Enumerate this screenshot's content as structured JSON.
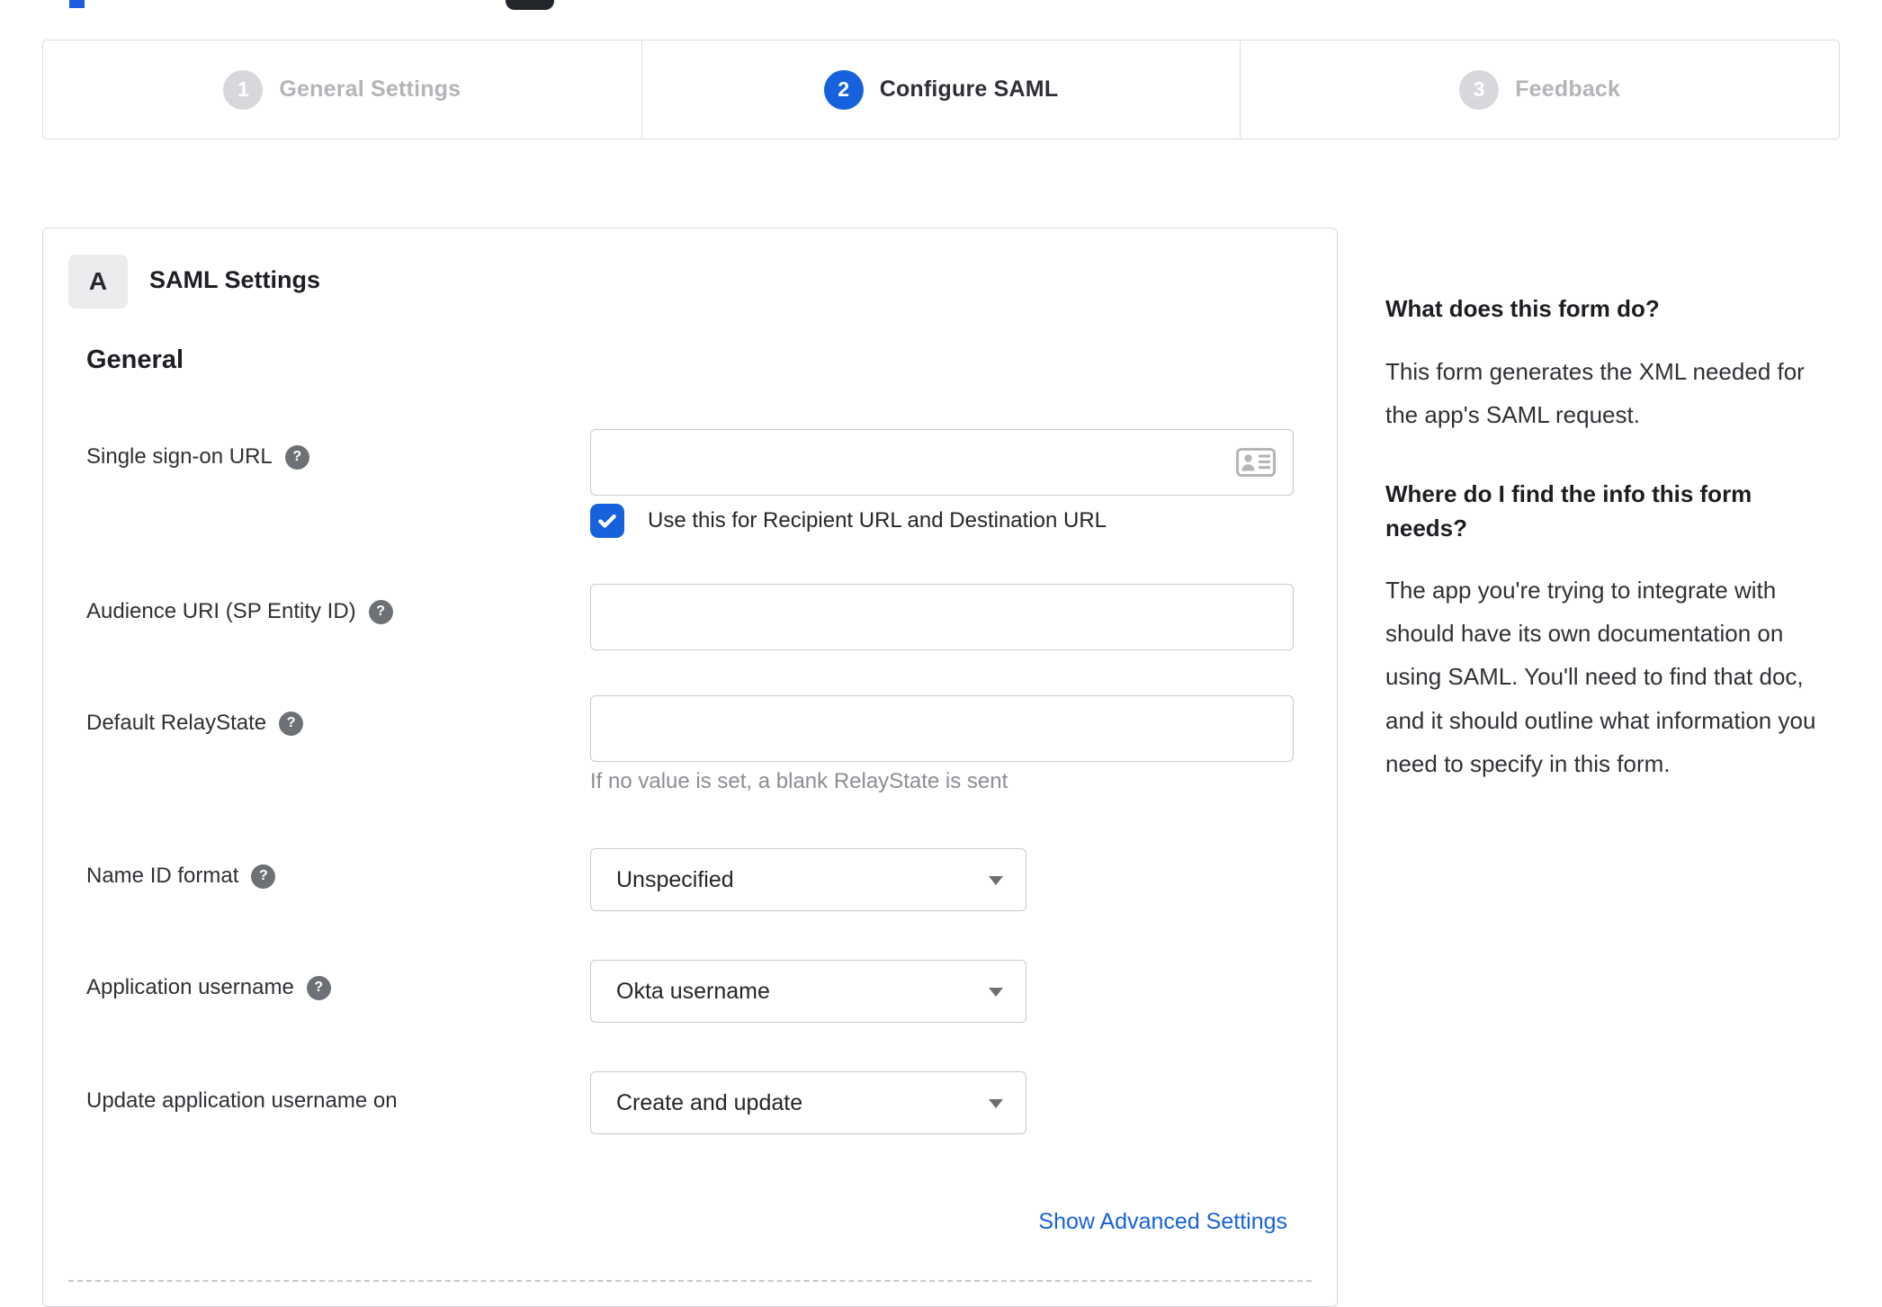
{
  "stepper": {
    "steps": [
      {
        "number": "1",
        "label": "General Settings",
        "state": "inactive"
      },
      {
        "number": "2",
        "label": "Configure SAML",
        "state": "active"
      },
      {
        "number": "3",
        "label": "Feedback",
        "state": "inactive"
      }
    ]
  },
  "panel": {
    "badge": "A",
    "title": "SAML Settings",
    "section_heading": "General",
    "fields": {
      "sso": {
        "label": "Single sign-on URL",
        "value": "",
        "checkbox_label": "Use this for Recipient URL and Destination URL",
        "checkbox_checked": true
      },
      "audience": {
        "label": "Audience URI (SP Entity ID)",
        "value": ""
      },
      "relaystate": {
        "label": "Default RelayState",
        "value": "",
        "hint": "If no value is set, a blank RelayState is sent"
      },
      "nameid": {
        "label": "Name ID format",
        "value": "Unspecified"
      },
      "appusername": {
        "label": "Application username",
        "value": "Okta username"
      },
      "update": {
        "label": "Update application username on",
        "value": "Create and update"
      }
    },
    "help_icon_glyph": "?",
    "advanced_link": "Show Advanced Settings"
  },
  "sidebar": {
    "q1": "What does this form do?",
    "a1": "This form generates the XML needed for the app's SAML request.",
    "q2": "Where do I find the info this form needs?",
    "a2": "The app you're trying to integrate with should have its own documentation on using SAML. You'll need to find that doc, and it should outline what information you need to specify in this form."
  },
  "colors": {
    "accent_blue": "#1662dd",
    "inactive_gray": "#b4b4b9",
    "border_gray": "#d9d9dd",
    "text_dark": "#2e3135"
  }
}
